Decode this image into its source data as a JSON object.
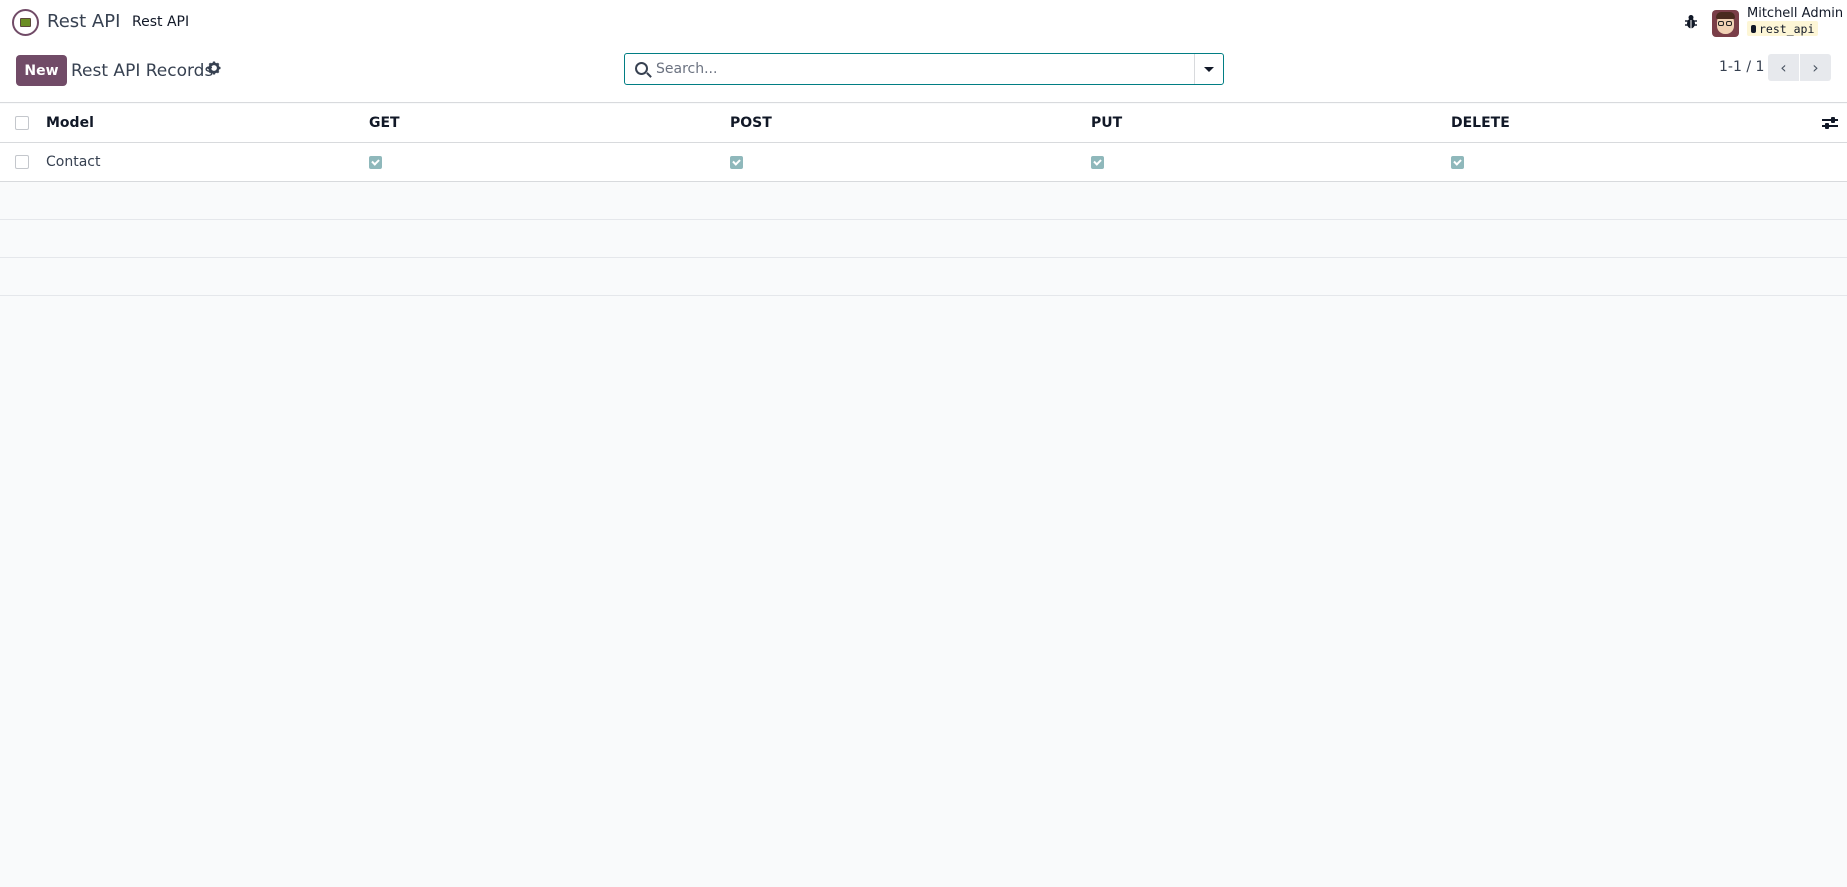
{
  "navbar": {
    "app_name": "Rest API",
    "menu_item": "Rest API",
    "user_name": "Mitchell Admin",
    "database": "rest_api"
  },
  "control_panel": {
    "new_button": "New",
    "title": "Rest API Records",
    "search_placeholder": "Search...",
    "pager": "1-1 / 1"
  },
  "list": {
    "columns": [
      "Model",
      "GET",
      "POST",
      "PUT",
      "DELETE"
    ],
    "rows": [
      {
        "model": "Contact",
        "get": true,
        "post": true,
        "put": true,
        "delete": true
      }
    ]
  },
  "colors": {
    "brand": "#714b67",
    "search_border": "#017e84",
    "checkbox_checked": "#8fb8bb"
  },
  "icons": [
    "app-logo-icon",
    "bug-icon",
    "gear-icon",
    "search-icon",
    "caret-down-icon",
    "chevron-left-icon",
    "chevron-right-icon",
    "column-settings-icon"
  ]
}
